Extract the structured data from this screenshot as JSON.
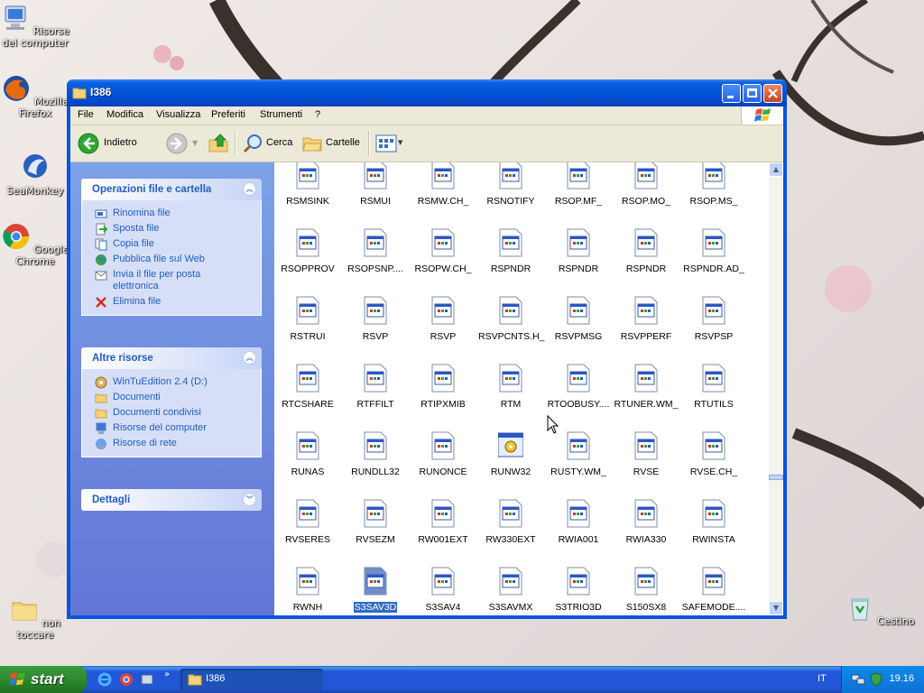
{
  "desktop": {
    "icons": [
      {
        "label": "Risorse del computer",
        "icon": "my-computer-icon"
      },
      {
        "label": "Mozilla Firefox",
        "icon": "firefox-icon"
      },
      {
        "label": "SeaMonkey",
        "icon": "seamonkey-icon"
      },
      {
        "label": "Google Chrome",
        "icon": "chrome-icon"
      },
      {
        "label": "non toccare",
        "icon": "folder-icon"
      },
      {
        "label": "Cestino",
        "icon": "recycle-bin-icon"
      }
    ]
  },
  "window": {
    "title": "I386",
    "menu": [
      "File",
      "Modifica",
      "Visualizza",
      "Preferiti",
      "Strumenti",
      "?"
    ],
    "toolbar": {
      "back": "Indietro",
      "search": "Cerca",
      "folders": "Cartelle"
    },
    "taskpane": {
      "file_tasks": {
        "title": "Operazioni file e cartella",
        "items": [
          "Rinomina file",
          "Sposta file",
          "Copia file",
          "Pubblica file sul Web",
          "Invia il file per posta elettronica",
          "Elimina file"
        ]
      },
      "other_places": {
        "title": "Altre risorse",
        "items": [
          "WinTuEdition 2.4 (D:)",
          "Documenti",
          "Documenti condivisi",
          "Risorse del computer",
          "Risorse di rete"
        ]
      },
      "details": {
        "title": "Dettagli"
      }
    },
    "files": [
      [
        "RSMSINK",
        "RSMUI",
        "RSMW.CH_",
        "RSNOTIFY",
        "RSOP.MF_",
        "RSOP.MO_",
        "RSOP.MS_"
      ],
      [
        "RSOPPROV",
        "RSOPSNP....",
        "RSOPW.CH_",
        "RSPNDR",
        "RSPNDR",
        "RSPNDR",
        "RSPNDR.AD_"
      ],
      [
        "RSTRUI",
        "RSVP",
        "RSVP",
        "RSVPCNTS.H_",
        "RSVPMSG",
        "RSVPPERF",
        "RSVPSP"
      ],
      [
        "RTCSHARE",
        "RTFFILT",
        "RTIPXMIB",
        "RTM",
        "RTOOBUSY....",
        "RTUNER.WM_",
        "RTUTILS"
      ],
      [
        "RUNAS",
        "RUNDLL32",
        "RUNONCE",
        "RUNW32",
        "RUSTY.WM_",
        "RVSE",
        "RVSE.CH_"
      ],
      [
        "RVSERES",
        "RVSEZM",
        "RW001EXT",
        "RW330EXT",
        "RWIA001",
        "RWIA330",
        "RWINSTA"
      ],
      [
        "RWNH",
        "S3SAV3D",
        "S3SAV4",
        "S3SAVMX",
        "S3TRIO3D",
        "S150SX8",
        "SAFEMODE...."
      ]
    ],
    "selected_file": "S3SAV3D"
  },
  "taskbar": {
    "start": "start",
    "task": "I386",
    "language": "IT",
    "clock": "19.16"
  }
}
